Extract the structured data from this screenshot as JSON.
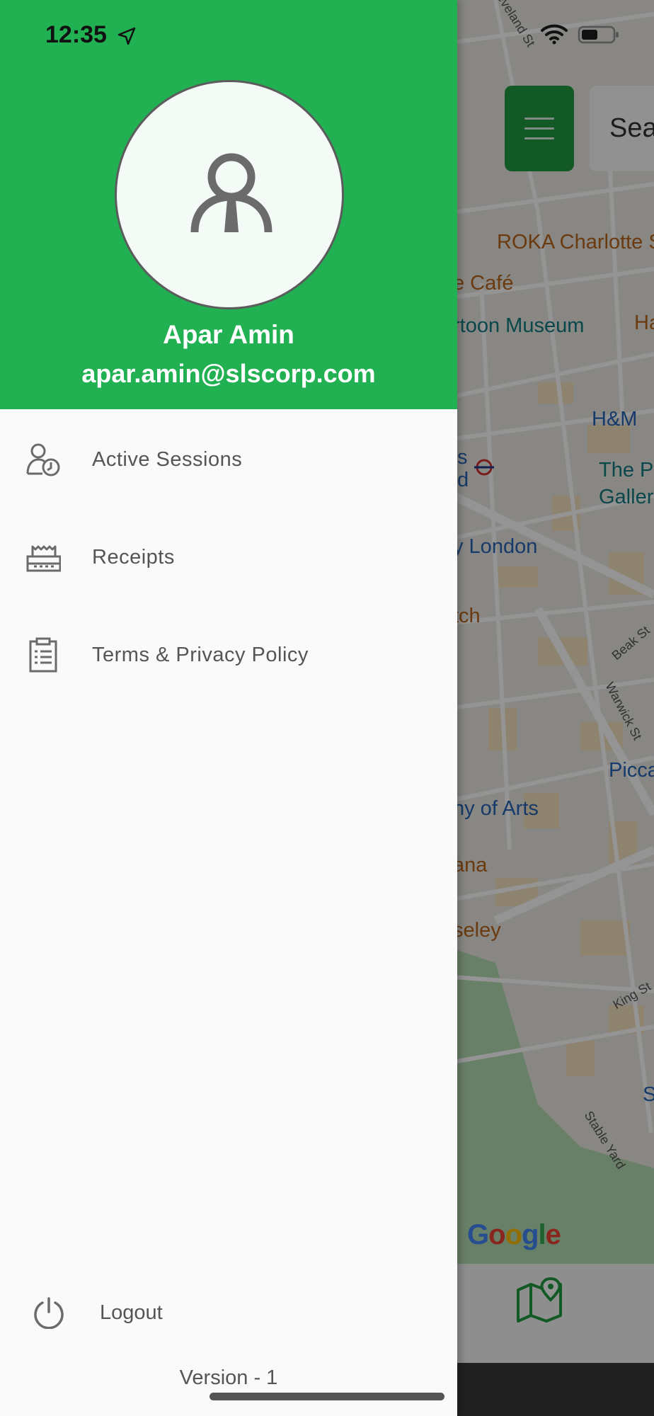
{
  "status_bar": {
    "time": "12:35",
    "icons": [
      "location-arrow-icon",
      "wifi-icon",
      "battery-icon"
    ]
  },
  "map": {
    "search_placeholder": "Sea",
    "labels": [
      {
        "text": "ROKA Charlotte S",
        "color": "orange"
      },
      {
        "text": "e Café",
        "color": "orange"
      },
      {
        "text": "rtoon Museum",
        "color": "teal"
      },
      {
        "text": "Ha",
        "color": "orange"
      },
      {
        "text": "H&M",
        "color": "blue"
      },
      {
        "text": "The P",
        "color": "teal"
      },
      {
        "text": "Galler",
        "color": "teal"
      },
      {
        "text": "s",
        "color": "blue"
      },
      {
        "text": "d",
        "color": "blue"
      },
      {
        "text": "y London",
        "color": "blue"
      },
      {
        "text": "tch",
        "color": "orange"
      },
      {
        "text": "Picca",
        "color": "blue"
      },
      {
        "text": "ny of Arts",
        "color": "blue"
      },
      {
        "text": "ana",
        "color": "orange"
      },
      {
        "text": "seley",
        "color": "orange"
      },
      {
        "text": "S",
        "color": "blue"
      },
      {
        "text": "eveland St",
        "color": "street"
      },
      {
        "text": "Beak St",
        "color": "street"
      },
      {
        "text": "Warwick St",
        "color": "street"
      },
      {
        "text": "King St",
        "color": "street"
      },
      {
        "text": "Stable Yard",
        "color": "street"
      }
    ],
    "attribution": [
      "G",
      "o",
      "o",
      "g",
      "l",
      "e"
    ]
  },
  "drawer": {
    "user": {
      "name": "Apar Amin",
      "email": "apar.amin@slscorp.com"
    },
    "menu": [
      {
        "label": "Active Sessions",
        "icon": "active-sessions-icon"
      },
      {
        "label": "Receipts",
        "icon": "receipt-icon"
      },
      {
        "label": "Terms & Privacy Policy",
        "icon": "clipboard-icon"
      }
    ],
    "logout_label": "Logout",
    "version": "Version - 1"
  },
  "colors": {
    "header_green": "#22b152",
    "button_green": "#1f9a43",
    "icon_gray": "#6b6b6b",
    "text_gray": "#555555"
  }
}
